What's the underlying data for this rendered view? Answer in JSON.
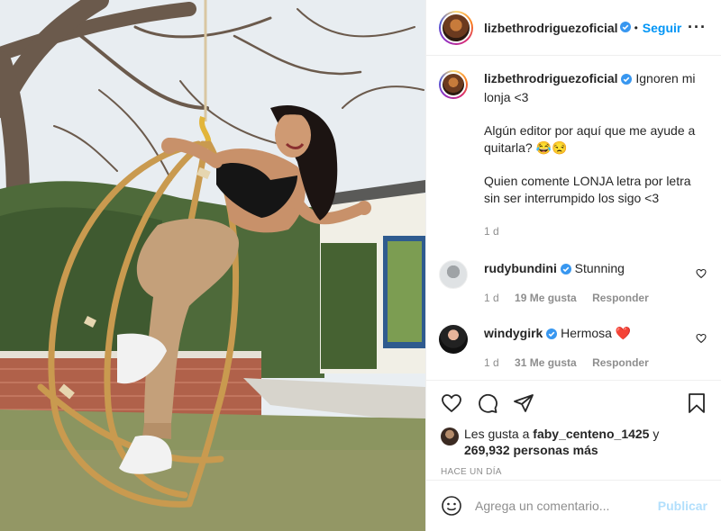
{
  "header": {
    "username": "lizbethrodriguezoficial",
    "separator": "•",
    "follow_label": "Seguir",
    "more_label": "···"
  },
  "caption": {
    "username": "lizbethrodriguezoficial",
    "line1": "Ignoren mi lonja <3",
    "line2": "Algún editor por aquí que me ayude a quitarla? 😂😒",
    "line3": "Quien comente LONJA letra por letra sin ser interrumpido los sigo <3",
    "time": "1 d"
  },
  "comments": [
    {
      "username": "rudybundini",
      "text": "Stunning",
      "time": "1 d",
      "likes": "19 Me gusta",
      "reply": "Responder"
    },
    {
      "username": "windygirk",
      "text": "Hermosa ❤️",
      "time": "1 d",
      "likes": "31 Me gusta",
      "reply": "Responder"
    }
  ],
  "likes": {
    "prefix": "Les gusta a",
    "liker": "faby_centeno_1425",
    "conj": "y",
    "others": "269,932 personas más"
  },
  "posted": "HACE UN DÍA",
  "add_comment": {
    "placeholder": "Agrega un comentario...",
    "publish_label": "Publicar"
  },
  "colors": {
    "link_blue": "#0095f6",
    "publish_disabled": "#b2dffc",
    "verified_blue": "#3897f0",
    "heart_red": "#ed4956"
  },
  "icons": [
    "verified-badge-icon",
    "more-options-icon",
    "heart-icon",
    "comment-icon",
    "share-icon",
    "bookmark-icon",
    "emoji-icon"
  ]
}
